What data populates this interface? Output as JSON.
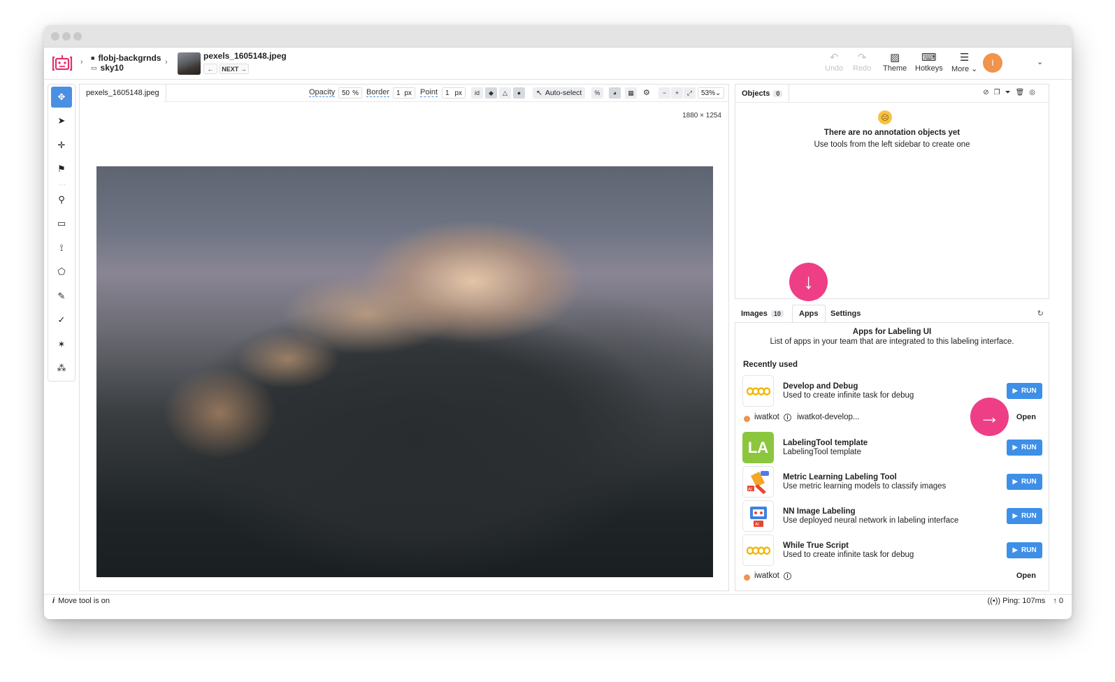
{
  "header": {
    "breadcrumb": {
      "project": "flobj-backgrnds",
      "dataset": "sky10"
    },
    "image_name": "pexels_1605148.jpeg",
    "prev_label": "←",
    "next_label": "NEXT →",
    "undo_label": "Undo",
    "redo_label": "Redo",
    "theme_label": "Theme",
    "hotkeys_label": "Hotkeys",
    "more_label": "More ⌄",
    "avatar_letter": "I"
  },
  "canvas": {
    "tab_label": "pexels_1605148.jpeg",
    "opacity_label": "Opacity",
    "opacity_value": "50",
    "opacity_unit": "%",
    "border_label": "Border",
    "border_value": "1",
    "border_unit": "px",
    "point_label": "Point",
    "point_value": "1",
    "point_unit": "px",
    "autoselect_label": "Auto-select",
    "zoom_value": "53%",
    "dimensions": "1880 × 1254"
  },
  "objects": {
    "tab_label": "Objects",
    "count": "0",
    "empty_title": "There are no annotation objects yet",
    "empty_subtitle": "Use tools from the left sidebar to create one"
  },
  "panel_tabs": {
    "images_label": "Images",
    "images_count": "10",
    "apps_label": "Apps",
    "settings_label": "Settings"
  },
  "apps": {
    "heading": "Apps for Labeling UI",
    "subheading": "List of apps in your team that are integrated to this labeling interface.",
    "recently_used_label": "Recently used",
    "run_label": "RUN",
    "open_label": "Open",
    "items": [
      {
        "title": "Develop and Debug",
        "description": "Used to create infinite task for debug",
        "icon": "infinity-icon"
      },
      {
        "title": "LabelingTool template",
        "description": "LabelingTool template",
        "icon": "la-icon",
        "icon_text": "LA"
      },
      {
        "title": "Metric Learning Labeling Tool",
        "description": "Use metric learning models to classify images",
        "icon": "paint-ai-icon"
      },
      {
        "title": "NN Image Labeling",
        "description": "Use deployed neural network in labeling interface",
        "icon": "robot-ai-icon"
      },
      {
        "title": "While True Script",
        "description": "Used to create infinite task for debug",
        "icon": "infinity-icon"
      }
    ],
    "tasks": [
      {
        "user": "iwatkot",
        "task": "iwatkot-develop..."
      },
      {
        "user": "iwatkot",
        "task": ""
      }
    ]
  },
  "status": {
    "message": "Move tool is on",
    "ping": "Ping: 107ms",
    "uploads": "0"
  },
  "colors": {
    "accent": "#4a90e2",
    "run_button": "#3d8fe8",
    "highlight": "#ee3f86",
    "avatar": "#f0934c",
    "la_icon": "#8cc63e"
  }
}
